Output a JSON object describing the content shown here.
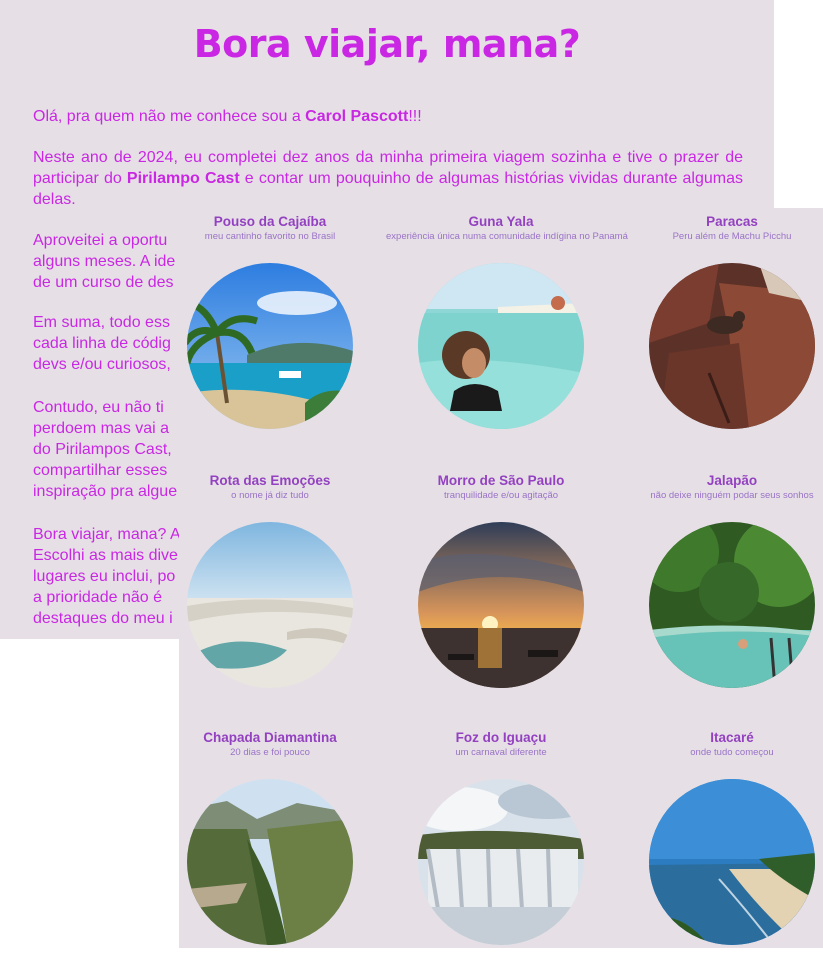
{
  "header": {
    "title": "Bora viajar, mana?"
  },
  "intro": {
    "p1_pre": "Olá, pra quem não me conhece sou a ",
    "p1_name": "Carol Pascott",
    "p1_post": "!!!",
    "p2_pre": "Neste ano de 2024, eu completei dez anos da minha primeira viagem sozinha e tive o prazer de participar do ",
    "p2_bold": "Pirilampo Cast",
    "p2_post": " e contar um pouquinho de algumas histórias vividas durante algumas delas.",
    "p3": "Aproveitei a oportu… alguns meses. A ide… de um curso de des…",
    "p3_l1": "Aproveitei a oportu",
    "p3_l2": "alguns meses. A ide",
    "p3_l3": "de um curso de des",
    "p4_l1": "Em suma, todo ess",
    "p4_l2": "cada linha de códig",
    "p4_l3": "devs e/ou curiosos,",
    "p5_l1": "Contudo, eu não ti",
    "p5_l2": "perdoem mas vai a",
    "p5_l3": "do Pirilampos Cast,",
    "p5_l4": "compartilhar esses",
    "p5_l5": "inspiração pra algue",
    "p6_l1": "Bora viajar, mana? A",
    "p6_l2": "Escolhi as mais dive",
    "p6_l3": "lugares eu inclui, po",
    "p6_l4": "a prioridade não é",
    "p6_l5": "destaques do meu i"
  },
  "gallery": {
    "items": [
      {
        "name": "Pouso da Cajaíba",
        "subtitle": "meu cantinho favorito no Brasil",
        "scene": "beach-palm"
      },
      {
        "name": "Guna Yala",
        "subtitle": "experiência única numa comunidade indígina no Panamá",
        "scene": "turquoise-water"
      },
      {
        "name": "Paracas",
        "subtitle": "Peru além de Machu Picchu",
        "scene": "sea-lion-rocks"
      },
      {
        "name": "Rota das Emoções",
        "subtitle": "o nome já diz tudo",
        "scene": "dunes-lagoon"
      },
      {
        "name": "Morro de São Paulo",
        "subtitle": "tranquilidade e/ou agitação",
        "scene": "sunset-sea"
      },
      {
        "name": "Jalapão",
        "subtitle": "não deixe ninguém podar seus sonhos",
        "scene": "jungle-pool"
      },
      {
        "name": "Chapada Diamantina",
        "subtitle": "20 dias e foi pouco",
        "scene": "canyon-valley"
      },
      {
        "name": "Foz do Iguaçu",
        "subtitle": "um carnaval diferente",
        "scene": "waterfall"
      },
      {
        "name": "Itacaré",
        "subtitle": "onde tudo começou",
        "scene": "coastline"
      }
    ]
  },
  "colors": {
    "accent": "#c927e3",
    "card_title": "#9341c0",
    "card_sub": "#9a72c7",
    "panel_bg": "#e6e0e6"
  }
}
